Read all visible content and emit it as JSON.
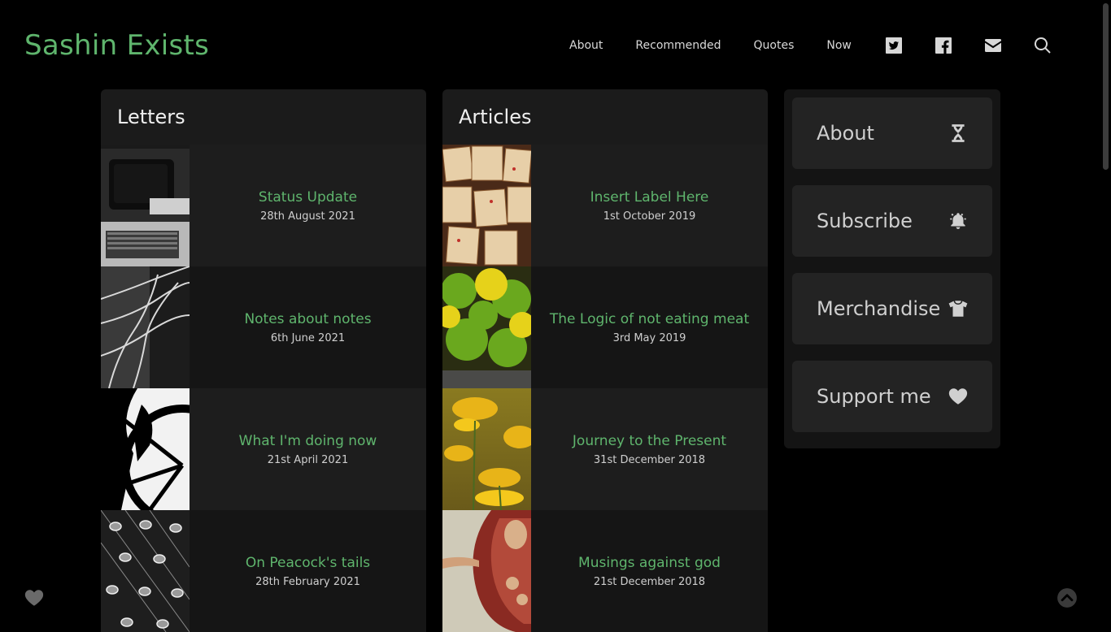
{
  "site": {
    "title": "Sashin Exists",
    "accent_color": "#5fb56d"
  },
  "nav": {
    "links": [
      "About",
      "Recommended",
      "Quotes",
      "Now"
    ],
    "icons": [
      "twitter-icon",
      "facebook-icon",
      "envelope-icon",
      "search-icon"
    ]
  },
  "letters": {
    "heading": "Letters",
    "items": [
      {
        "title": "Status Update",
        "date": "28th August 2021",
        "image": "vintage-computer-photo"
      },
      {
        "title": "Notes about notes",
        "date": "6th June 2021",
        "image": "chains-photo"
      },
      {
        "title": "What I'm doing now",
        "date": "21st April 2021",
        "image": "bicycle-wheel-photo"
      },
      {
        "title": "On Peacock's tails",
        "date": "28th February 2021",
        "image": "peacock-feathers-photo"
      }
    ]
  },
  "articles": {
    "heading": "Articles",
    "items": [
      {
        "title": "Insert Label Here",
        "date": "1st October 2019",
        "image": "wooden-plaques-photo"
      },
      {
        "title": "The Logic of not eating meat",
        "date": "3rd May 2019",
        "image": "citrus-fruits-photo"
      },
      {
        "title": "Journey to the Present",
        "date": "31st December 2018",
        "image": "yellow-flowers-photo"
      },
      {
        "title": "Musings against god",
        "date": "21st December 2018",
        "image": "creation-of-adam-photo"
      }
    ]
  },
  "sidebar": {
    "cards": [
      {
        "label": "About",
        "icon": "dna-icon"
      },
      {
        "label": "Subscribe",
        "icon": "bell-icon"
      },
      {
        "label": "Merchandise",
        "icon": "tshirt-icon"
      },
      {
        "label": "Support me",
        "icon": "heart-icon"
      }
    ]
  }
}
